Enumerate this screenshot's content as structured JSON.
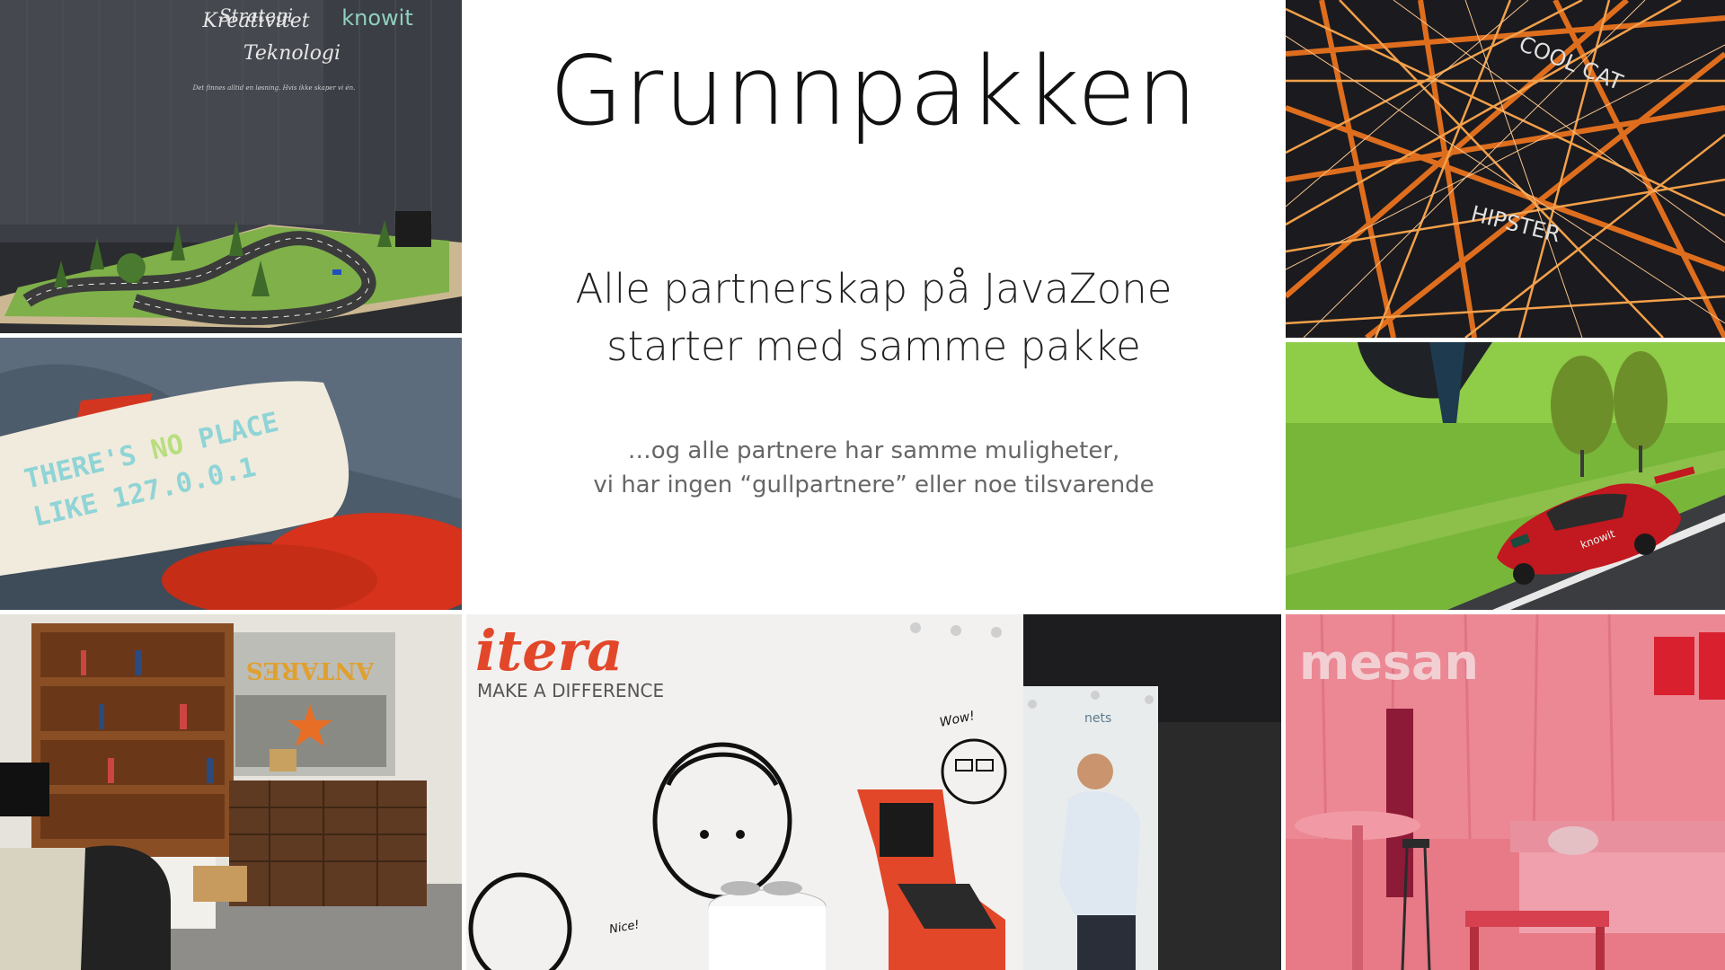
{
  "slide": {
    "title": "Grunnpakken",
    "subtitle_lines": [
      "Alle partnerskap på JavaZone",
      "starter med samme pakke"
    ],
    "note_lines": [
      "…og alle partnere har samme muligheter,",
      "vi har ingen “gullpartnere” eller noe tilsvarende"
    ]
  },
  "photos": {
    "knowit_booth": {
      "wall_lines": [
        "Strategi",
        "Kreativitet",
        "Teknologi"
      ],
      "logo": "knowit",
      "small_text": "Det finnes alltid en løsning. Hvis ikke skaper vi én."
    },
    "pillow": {
      "line1_a": "THERE'S ",
      "line1_b": "NO",
      "line1_c": " PLACE",
      "line2": "LIKE 127.0.0.1"
    },
    "antares_booth": {
      "sign": "ANTARES"
    },
    "itera_booth": {
      "logo": "itera",
      "tagline": "MAKE A DIFFERENCE",
      "wow": "Wow!",
      "nice": "Nice!",
      "nets_logo": "nets"
    },
    "string_art": {
      "label1": "COOL CAT",
      "label2": "HIPSTER"
    },
    "slot_car": {
      "car_text": "knowit"
    },
    "mesan_booth": {
      "logo": "mesan"
    }
  },
  "colors": {
    "background": "#ffffff",
    "title_text": "#111111",
    "note_text": "#666666",
    "itera_red": "#e2472a",
    "mesan_pink": "#e77a86",
    "string_orange": "#e9731f"
  }
}
